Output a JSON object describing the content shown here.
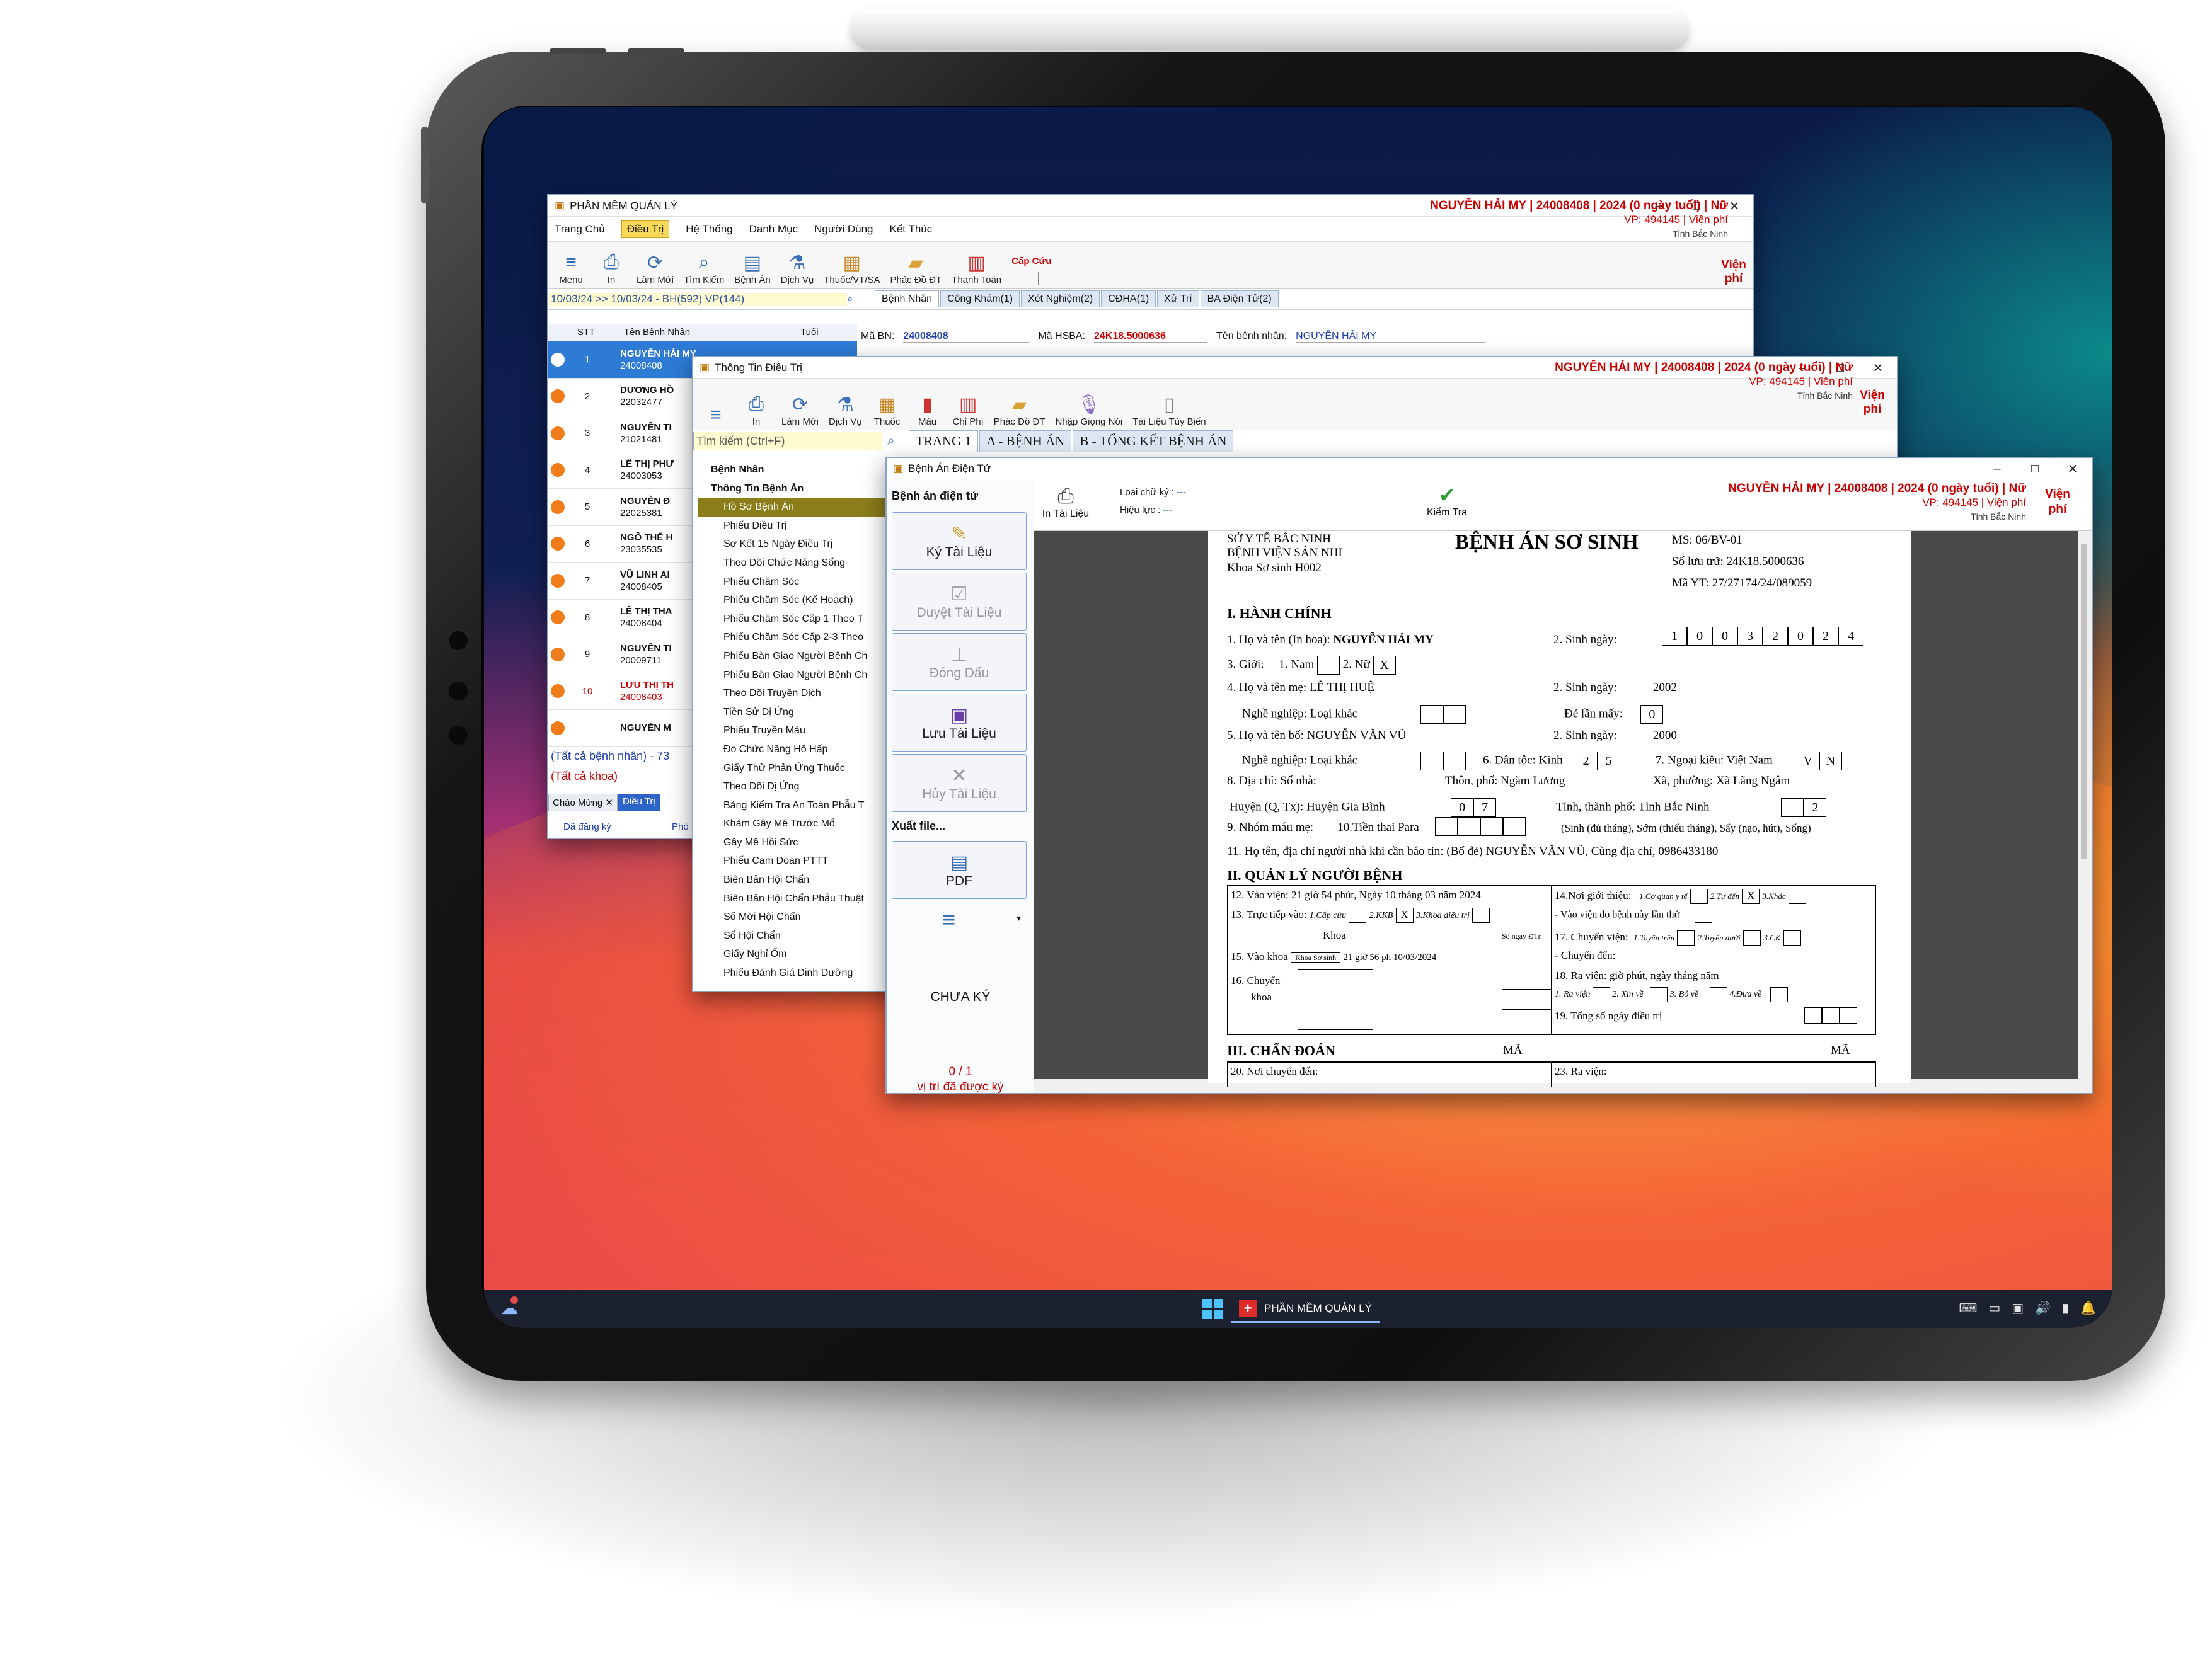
{
  "main_window": {
    "title": "PHẦN MỀM QUẢN LÝ",
    "menu": [
      "Trang Chủ",
      "Điều Trị",
      "Hệ Thống",
      "Danh Mục",
      "Người Dùng",
      "Kết Thúc"
    ],
    "toolbar": [
      "Menu",
      "In",
      "Làm Mới",
      "Tìm Kiếm",
      "Bệnh Án",
      "Dịch Vụ",
      "Thuốc/VT/SA",
      "Phác Đồ ĐT",
      "Thanh Toán"
    ],
    "emergency": "Cấp Cứu",
    "filter": "10/03/24 >> 10/03/24 - BH(592) VP(144)",
    "tabs": [
      "Bệnh Nhân",
      "Công Khám(1)",
      "Xét Nghiệm(2)",
      "CĐHA(1)",
      "Xử Trí",
      "BA Điện Tử(2)"
    ],
    "list_headers": [
      "STT",
      "Tên Bệnh Nhân",
      "Tuổi"
    ],
    "patients": [
      {
        "stt": "1",
        "name": "NGUYỄN HẢI MY",
        "code": "24008408"
      },
      {
        "stt": "2",
        "name": "DƯƠNG HỒ",
        "code": "22032477"
      },
      {
        "stt": "3",
        "name": "NGUYỄN TI",
        "code": "21021481"
      },
      {
        "stt": "4",
        "name": "LÊ THỊ PHƯ",
        "code": "24003053"
      },
      {
        "stt": "5",
        "name": "NGUYỄN Đ",
        "code": "22025381"
      },
      {
        "stt": "6",
        "name": "NGÔ THẾ H",
        "code": "23035535"
      },
      {
        "stt": "7",
        "name": "VŨ LINH AI",
        "code": "24008405"
      },
      {
        "stt": "8",
        "name": "LÊ THỊ THA",
        "code": "24008404"
      },
      {
        "stt": "9",
        "name": "NGUYỄN TI",
        "code": "20009711"
      },
      {
        "stt": "10",
        "name": "LƯU THỊ TH",
        "code": "24008403"
      },
      {
        "stt": "",
        "name": "NGUYỄN M",
        "code": ""
      }
    ],
    "fields": {
      "ma_bn_label": "Mã BN:",
      "ma_bn": "24008408",
      "ma_hsba_label": "Mã HSBA:",
      "ma_hsba": "24K18.5000636",
      "ten_label": "Tên bệnh nhân:",
      "ten": "NGUYỄN HẢI MY"
    },
    "all_patients": "(Tất cả bệnh nhân) - 73",
    "all_depts": "(Tất cả khoa)",
    "bottom_tabs": [
      "Chào Mừng",
      "Điều Trị"
    ],
    "registered": "Đã đăng ký",
    "room": "Phò"
  },
  "patient_header": {
    "line1": "NGUYỄN HẢI MY | 24008408 | 2024 (0 ngày tuổi) | Nữ",
    "line2": "VP: 494145 | Viện phí",
    "line3": "Tỉnh Bắc Ninh",
    "fee": "Viện phí"
  },
  "treatment_window": {
    "title": "Thông Tin Điều Trị",
    "toolbar": [
      "In",
      "Làm Mới",
      "Dịch Vụ",
      "Thuốc",
      "Máu",
      "Chỉ Phí",
      "Phác Đồ ĐT",
      "Nhập Giọng Nói",
      "Tài Liệu Tùy Biến"
    ],
    "search": "Tìm kiếm (Ctrl+F)",
    "tabs": [
      "TRANG 1",
      "A - BỆNH ÁN",
      "B - TỔNG KẾT BỆNH ÁN"
    ],
    "tree_root1": "Bệnh Nhân",
    "tree_root2": "Thông Tin Bệnh Án",
    "tree": [
      "Hồ Sơ Bệnh Án",
      "Phiếu Điều Trị",
      "Sơ Kết 15 Ngày Điều Trị",
      "Theo Dõi Chức Năng Sống",
      "Phiếu Chăm Sóc",
      "Phiếu Chăm Sóc (Kế Hoạch)",
      "Phiếu Chăm Sóc Cấp 1 Theo T",
      "Phiếu Chăm Sóc Cấp 2-3 Theo",
      "Phiếu Bàn Giao Người Bệnh Ch",
      "Phiếu Bàn Giao Người Bệnh Ch",
      "Theo Dõi Truyền Dịch",
      "Tiền Sử Dị Ứng",
      "Phiếu Truyền Máu",
      "Đo Chức Năng Hô Hấp",
      "Giấy Thử Phản Ứng Thuốc",
      "Theo Dõi Dị Ứng",
      "Bảng Kiểm Tra An Toàn Phẫu T",
      "Khám Gây Mê Trước Mổ",
      "Gây Mê Hồi Sức",
      "Phiếu Cam Đoan PTTT",
      "Biên Bản Hội Chẩn",
      "Biên Bản Hội Chẩn Phẫu Thuật",
      "Sổ Mời Hội Chẩn",
      "Sổ Hội Chẩn",
      "Giấy Nghỉ Ốm",
      "Phiếu Đánh Giá Dinh Dưỡng"
    ]
  },
  "emr_window": {
    "title": "Bệnh Án Điện Tử",
    "section": "Bệnh án điện tử",
    "buttons": [
      "Ký Tài Liệu",
      "Duyệt Tài Liệu",
      "Đóng Dấu",
      "Lưu Tài Liệu",
      "Hủy Tài Liệu"
    ],
    "export": "Xuất file...",
    "pdf": "PDF",
    "status": "CHƯA KÝ",
    "sign_count": "0 / 1",
    "sign_text": "vị trí đã được ký",
    "print": "In Tài Liệu",
    "sig_type_label": "Loại chữ ký :",
    "sig_type": "---",
    "valid_label": "Hiệu lực :",
    "valid": "---",
    "check": "Kiểm Tra"
  },
  "document": {
    "org1": "SỞ Y TẾ BẮC NINH",
    "org2": "BỆNH VIỆN SẢN NHI",
    "dept": "Khoa Sơ sinh   H002",
    "title": "BỆNH ÁN SƠ SINH",
    "ms": "MS: 06/BV-01",
    "storage": "Số lưu trữ: 24K18.5000636",
    "yt": "Mã YT: 27/27174/24/089059",
    "s1": "I. HÀNH CHÍNH",
    "name_label": "1. Họ và tên (In hoa):",
    "name": "NGUYỄN HẢI MY",
    "dob_label": "2. Sinh ngày:",
    "dob_digits": [
      "1",
      "0",
      "0",
      "3",
      "2",
      "0",
      "2",
      "4"
    ],
    "gender": "3. Giới:",
    "male": "1. Nam",
    "female": "2. Nữ",
    "mark": "X",
    "mother": "4. Họ và tên mẹ: LÊ THỊ HUỆ",
    "mother_dob": "2. Sinh ngày:",
    "mother_year": "2002",
    "job1": "Nghề nghiệp: Loại khác",
    "birth_order": "Đẻ lần mấy:",
    "birth_order_v": "0",
    "father": "5. Họ và tên bố: NGUYỄN VĂN VŨ",
    "father_dob": "2. Sinh ngày:",
    "father_year": "2000",
    "job2": "Nghề nghiệp: Loại khác",
    "ethnic": "6. Dân tộc: Kinh",
    "ethnic_code": [
      "2",
      "5"
    ],
    "foreign": "7. Ngoại kiều: Việt Nam",
    "foreign_code": [
      "V",
      "N"
    ],
    "addr": "8. Địa chỉ: Số nhà:",
    "village": "Thôn, phố: Ngăm Lương",
    "commune": "Xã, phường: Xã Lãng Ngâm",
    "district": "Huyện (Q, Tx): Huyện Gia Bình",
    "district_code": [
      "0",
      "7"
    ],
    "province": "Tỉnh, thành phố: Tỉnh Bắc Ninh",
    "province_code": "2",
    "blood": "9. Nhóm máu mẹ:",
    "para": "10.Tiền thai Para",
    "para_note": "(Sinh (đủ tháng), Sớm (thiếu tháng), Sẩy (nạo, hút), Sống)",
    "contact": "11. Họ tên, địa chỉ người nhà khi cần báo tin: (Bố đẻ) NGUYỄN VĂN VŨ, Cùng địa chỉ, 0986433180",
    "s2": "II. QUẢN LÝ NGƯỜI BỆNH",
    "admit": "12. Vào viện: 21 giờ 54 phút, Ngày 10 tháng 03 năm 2024",
    "direct": "13. Trực tiếp vào:",
    "direct_opts": [
      "1.Cấp cứu",
      "2.KKB",
      "3.Khoa điều trị"
    ],
    "dept_h": "Khoa",
    "days_h": "Số ngày ĐTr",
    "into": "15. Vào khoa",
    "into_v": "Khoa Sơ sinh",
    "into_t": "21 giờ 56 ph 10/03/2024",
    "transfer": "16. Chuyển",
    "transfer2": "khoa",
    "referral": "14.Nơi giới thiệu:",
    "ref_opts": [
      "1.Cơ quan y tế",
      "2.Tự đến",
      "3.Khác"
    ],
    "referral2": "- Vào viện do bệnh này lần thứ",
    "move": "17. Chuyển viện:",
    "move_opts": [
      "1.Tuyến trên",
      "2.Tuyến dưới",
      "3.CK"
    ],
    "move2": "- Chuyển đến:",
    "discharge": "18. Ra viện:    giờ    phút, ngày    tháng    năm",
    "dis_opts": [
      "1. Ra viện",
      "2. Xin về",
      "3. Bỏ về",
      "4.Đưa về"
    ],
    "total": "19. Tổng số ngày điều trị",
    "s3": "III. CHẨN ĐOÁN",
    "code": "MÃ",
    "from": "20. Nơi chuyển đến:",
    "discharge_dx": "23. Ra viện:"
  },
  "taskbar": {
    "app": "PHẦN MỀM QUẢN LÝ"
  },
  "colors": {
    "accent": "#3b6fb5",
    "patient_red": "#c00000",
    "selected_tree": "#8b7d1a"
  }
}
